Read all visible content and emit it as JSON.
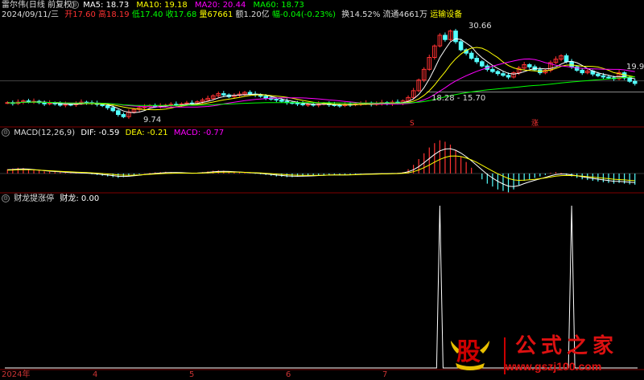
{
  "header": {
    "stock_name": "雷尔伟(日线 前复权)",
    "date": "2024/09/11/三",
    "open_label": "开17.60",
    "high_label": "高18.19",
    "low_label": "低17.40",
    "close_label": "收17.68",
    "volume_label": "量67661",
    "amount_label": "额1.20亿",
    "change_label": "幅-0.04(-0.23%)",
    "turnover_label": "换14.52%",
    "float_label": "流通4661万",
    "industry_label": "运输设备"
  },
  "ma": {
    "ma5": "MA5: 18.73",
    "ma10": "MA10: 19.18",
    "ma20": "MA20: 20.44",
    "ma60": "MA60: 18.73"
  },
  "price_annotations": {
    "high": "30.66",
    "low": "9.74",
    "range": "18.28 - 15.70",
    "right": "19.90"
  },
  "markers": {
    "m1": "S",
    "m2": "涨"
  },
  "macd": {
    "title": "MACD(12,26,9)",
    "dif": "DIF: -0.59",
    "dea": "DEA: -0.21",
    "macd": "MACD: -0.77"
  },
  "indicator": {
    "title": "财龙提涨停",
    "value": "财龙: 0.00"
  },
  "x_axis": [
    "2024年",
    "4",
    "5",
    "6",
    "7"
  ],
  "watermark": {
    "logo": "股",
    "chars": "公式之家",
    "url": "www.gszj100.com"
  },
  "colors": {
    "ma5": "#ffffff",
    "ma10": "#ffff00",
    "ma20": "#ff00ff",
    "ma60": "#00ff00",
    "up": "#ff3232",
    "down": "#54ffff",
    "grid": "#800000"
  },
  "chart_data": {
    "type": "line",
    "price_candles_close": [
      13.2,
      13.0,
      13.3,
      13.6,
      13.4,
      13.5,
      13.2,
      12.9,
      13.1,
      13.0,
      12.6,
      12.8,
      12.7,
      13.0,
      13.3,
      13.2,
      13.0,
      12.8,
      12.5,
      12.0,
      11.3,
      10.4,
      9.9,
      11.0,
      11.6,
      12.0,
      12.2,
      12.5,
      12.3,
      12.4,
      12.6,
      12.8,
      12.7,
      12.9,
      13.1,
      13.0,
      13.4,
      13.8,
      14.2,
      14.8,
      15.3,
      15.0,
      14.6,
      14.9,
      15.2,
      15.6,
      15.2,
      15.0,
      14.7,
      14.3,
      14.0,
      13.8,
      13.5,
      13.2,
      13.1,
      12.9,
      12.7,
      12.8,
      12.6,
      12.9,
      13.0,
      12.7,
      12.6,
      12.5,
      12.8,
      12.7,
      12.9,
      13.0,
      13.1,
      12.8,
      13.0,
      13.2,
      12.9,
      13.3,
      13.1,
      13.6,
      14.4,
      16.0,
      18.5,
      21.0,
      23.8,
      26.5,
      29.0,
      28.0,
      30.0,
      27.5,
      25.6,
      24.8,
      23.6,
      22.8,
      21.8,
      21.0,
      20.5,
      20.0,
      19.6,
      19.2,
      20.2,
      21.3,
      22.1,
      21.6,
      20.9,
      20.2,
      20.8,
      22.6,
      23.4,
      24.2,
      22.8,
      21.6,
      20.8,
      20.2,
      20.6,
      19.9,
      19.5,
      19.2,
      19.0,
      18.8,
      20.2,
      19.0,
      18.2,
      17.7
    ],
    "macd_hist": [
      0.3,
      0.35,
      0.4,
      0.38,
      0.32,
      0.25,
      0.2,
      0.15,
      0.12,
      0.1,
      0.08,
      0.05,
      0.04,
      0.03,
      0.02,
      0.0,
      -0.05,
      -0.1,
      -0.15,
      -0.2,
      -0.25,
      -0.3,
      -0.25,
      -0.2,
      -0.1,
      -0.05,
      0.02,
      0.05,
      0.08,
      0.1,
      0.12,
      0.1,
      0.08,
      0.05,
      0.02,
      0.0,
      0.05,
      0.1,
      0.15,
      0.2,
      0.22,
      0.2,
      0.15,
      0.1,
      0.08,
      0.05,
      0.02,
      -0.02,
      -0.05,
      -0.1,
      -0.15,
      -0.2,
      -0.22,
      -0.25,
      -0.25,
      -0.22,
      -0.2,
      -0.18,
      -0.15,
      -0.12,
      -0.1,
      -0.08,
      -0.1,
      -0.12,
      -0.1,
      -0.08,
      -0.05,
      -0.02,
      0.0,
      -0.02,
      0.0,
      0.02,
      0.0,
      0.02,
      0.05,
      0.1,
      0.3,
      0.6,
      1.0,
      1.4,
      1.8,
      2.1,
      2.3,
      2.2,
      2.0,
      1.6,
      1.2,
      0.8,
      0.4,
      0.0,
      -0.4,
      -0.7,
      -0.9,
      -1.1,
      -1.2,
      -1.3,
      -1.1,
      -0.8,
      -0.5,
      -0.4,
      -0.3,
      -0.2,
      -0.1,
      0.05,
      0.1,
      0.05,
      -0.1,
      -0.2,
      -0.3,
      -0.4,
      -0.45,
      -0.5,
      -0.55,
      -0.6,
      -0.65,
      -0.7,
      -0.65,
      -0.7,
      -0.75,
      -0.77
    ],
    "indicator_spikes": [
      {
        "index": 82,
        "value": 1
      },
      {
        "index": 107,
        "value": 1
      }
    ]
  }
}
